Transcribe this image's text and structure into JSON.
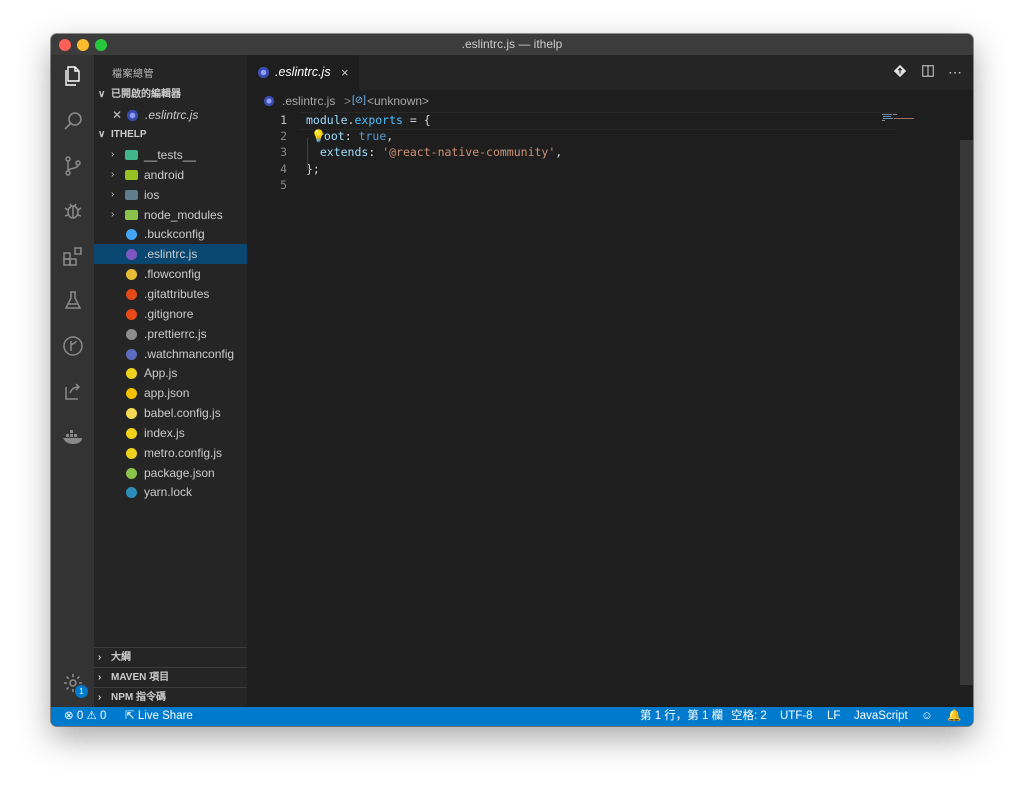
{
  "window": {
    "title": ".eslintrc.js — ithelp"
  },
  "activity_bar": {
    "items": [
      "files-icon",
      "search-icon",
      "source-control-icon",
      "debug-icon",
      "extensions-icon",
      "test-flask-icon",
      "gitlens-icon",
      "live-share-icon",
      "docker-icon"
    ],
    "settings_badge": "1"
  },
  "sidebar": {
    "title": "檔案總管",
    "open_editors": {
      "label": "已開啟的編輯器",
      "files": [
        {
          "name": ".eslintrc.js",
          "icon": "eslint-icon"
        }
      ]
    },
    "project": {
      "label": "ITHELP",
      "items": [
        {
          "name": "__tests__",
          "type": "folder",
          "icon": "tests-folder-icon",
          "color": "#3fb68b"
        },
        {
          "name": "android",
          "type": "folder",
          "icon": "android-folder-icon",
          "color": "#97c024"
        },
        {
          "name": "ios",
          "type": "folder",
          "icon": "ios-folder-icon",
          "color": "#5f7c8a"
        },
        {
          "name": "node_modules",
          "type": "folder",
          "icon": "node-folder-icon",
          "color": "#8bc34a"
        },
        {
          "name": ".buckconfig",
          "type": "file",
          "icon": "file-icon",
          "color": "#42a5f5"
        },
        {
          "name": ".eslintrc.js",
          "type": "file",
          "icon": "eslint-icon",
          "color": "#7e57c2",
          "selected": true
        },
        {
          "name": ".flowconfig",
          "type": "file",
          "icon": "flow-icon",
          "color": "#e8bd36"
        },
        {
          "name": ".gitattributes",
          "type": "file",
          "icon": "git-icon",
          "color": "#e64a19"
        },
        {
          "name": ".gitignore",
          "type": "file",
          "icon": "git-icon",
          "color": "#e64a19"
        },
        {
          "name": ".prettierrc.js",
          "type": "file",
          "icon": "prettier-icon",
          "color": "#8d8d8d"
        },
        {
          "name": ".watchmanconfig",
          "type": "file",
          "icon": "watchman-icon",
          "color": "#5c6bc0"
        },
        {
          "name": "App.js",
          "type": "file",
          "icon": "js-icon",
          "color": "#f0d11c"
        },
        {
          "name": "app.json",
          "type": "file",
          "icon": "json-icon",
          "color": "#f5c000"
        },
        {
          "name": "babel.config.js",
          "type": "file",
          "icon": "babel-icon",
          "color": "#f5da55"
        },
        {
          "name": "index.js",
          "type": "file",
          "icon": "js-icon",
          "color": "#f0d11c"
        },
        {
          "name": "metro.config.js",
          "type": "file",
          "icon": "js-icon",
          "color": "#f0d11c"
        },
        {
          "name": "package.json",
          "type": "file",
          "icon": "nodejs-icon",
          "color": "#8bc34a"
        },
        {
          "name": "yarn.lock",
          "type": "file",
          "icon": "yarn-icon",
          "color": "#2c8ebb"
        }
      ]
    },
    "bottom_sections": [
      "大綱",
      "MAVEN 項目",
      "NPM 指令碼"
    ]
  },
  "tab": {
    "label": ".eslintrc.js",
    "close": "×"
  },
  "breadcrumb": {
    "file": ".eslintrc.js",
    "symbol": "<unknown>",
    "separator": ">"
  },
  "editor": {
    "line_numbers": [
      "1",
      "2",
      "3",
      "4",
      "5"
    ],
    "lines": [
      {
        "parts": [
          [
            "kw",
            "module"
          ],
          [
            "",
            "."
          ],
          [
            "prop",
            "exports"
          ],
          [
            "",
            " = {"
          ]
        ]
      },
      {
        "parts": [
          [
            "",
            ""
          ],
          [
            "kw",
            "root"
          ],
          [
            "",
            ": "
          ],
          [
            "bool",
            "true"
          ],
          [
            "",
            ","
          ]
        ]
      },
      {
        "parts": [
          [
            "",
            "  "
          ],
          [
            "kw",
            "extends"
          ],
          [
            "",
            ": "
          ],
          [
            "str",
            "'@react-native-community'"
          ],
          [
            "",
            ","
          ]
        ]
      },
      {
        "parts": [
          [
            "",
            "};"
          ]
        ]
      },
      {
        "parts": []
      }
    ]
  },
  "status_bar": {
    "errors": "0",
    "warnings": "0",
    "live_share": "Live Share",
    "position": "第 1 行，第 1 欄",
    "indent": "空格: 2",
    "encoding": "UTF-8",
    "eol": "LF",
    "language": "JavaScript"
  }
}
